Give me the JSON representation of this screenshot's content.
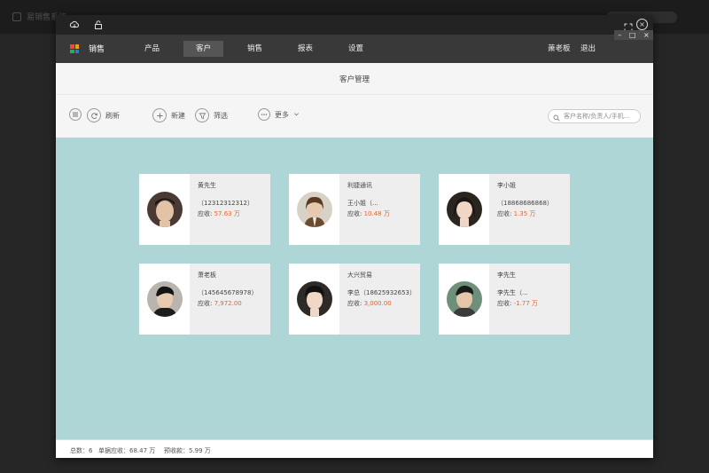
{
  "desktop": {
    "title": "易销售系统"
  },
  "window": {
    "controls": {
      "minimize": "–",
      "maximize": "□",
      "close": "×"
    }
  },
  "nav": {
    "app_title": "销售",
    "tabs": [
      "产品",
      "客户",
      "销售",
      "报表",
      "设置"
    ],
    "active_tab": "客户",
    "user": "萧老板",
    "logout": "退出"
  },
  "page": {
    "title": "客户管理"
  },
  "toolbar": {
    "refresh": "刷新",
    "new": "新建",
    "filter": "筛选",
    "more": "更多",
    "search_placeholder": "客户名称/负责人/手机..."
  },
  "customers": [
    {
      "name": "黄先生",
      "contact": "（12312312312）",
      "receivable_label": "应收:",
      "receivable": "57.63 万"
    },
    {
      "name": "利捷通讯",
      "contact": "王小姐（...",
      "receivable_label": "应收:",
      "receivable": "10.48 万"
    },
    {
      "name": "李小姐",
      "contact": "（18868686868）",
      "receivable_label": "应收:",
      "receivable": "1.35 万"
    },
    {
      "name": "萧老板",
      "contact": "（145645678978）",
      "receivable_label": "应收:",
      "receivable": "7,972.00"
    },
    {
      "name": "大兴贸易",
      "contact": "李总（18625932653）",
      "receivable_label": "应收:",
      "receivable": "3,000.00"
    },
    {
      "name": "李先生",
      "contact": "李先生（...",
      "receivable_label": "应收:",
      "receivable": "-1.77 万"
    }
  ],
  "footer": {
    "total": "总数：6",
    "receivable": "单据应收：68.47 万",
    "prepaid": "预收款：5.99 万"
  },
  "colors": {
    "content_bg": "#aed6d7",
    "accent_amount": "#e8632e",
    "nav_bg": "#393939",
    "titlebar_bg": "#232323"
  }
}
